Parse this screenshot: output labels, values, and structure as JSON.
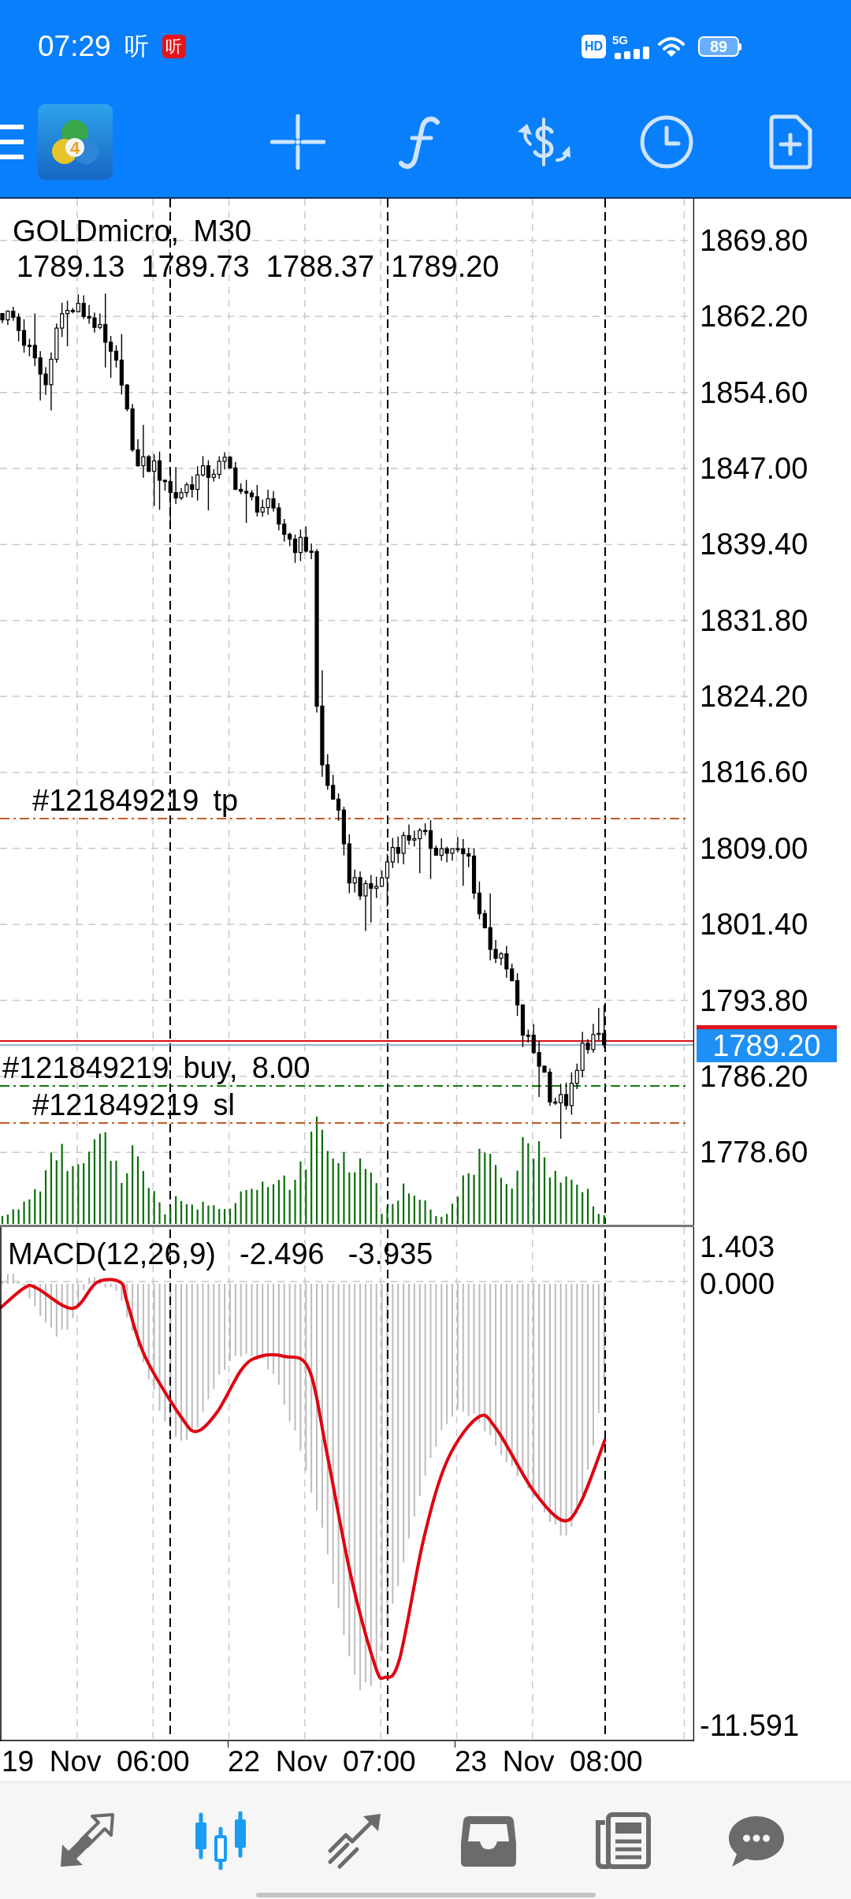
{
  "status_bar": {
    "time": "07:29",
    "notifications": [
      {
        "kind": "glyph",
        "text": "听"
      },
      {
        "kind": "badge",
        "text": "听"
      }
    ],
    "network_badge": "HD",
    "network_type": "5G",
    "battery": "89"
  },
  "toolbar": {
    "logo_mark": "4"
  },
  "chart": {
    "title": "GOLDmicro, M30",
    "ohlc": [
      "1789.13",
      "1789.73",
      "1788.37",
      "1789.20"
    ],
    "orders": [
      {
        "kind": "tp",
        "label": "#121849219 tp"
      },
      {
        "kind": "buy",
        "label": "#121849219 buy, 8.00"
      },
      {
        "kind": "sl",
        "label": "#121849219 sl"
      }
    ],
    "price_axis": [
      "1869.80",
      "1862.20",
      "1854.60",
      "1847.00",
      "1839.40",
      "1831.80",
      "1824.20",
      "1816.60",
      "1809.00",
      "1801.40",
      "1793.80",
      "1786.20",
      "1778.60"
    ],
    "current_price": "1789.20"
  },
  "macd": {
    "label": "MACD(12,26,9)",
    "values": [
      "-2.496",
      "-3.935"
    ],
    "axis": [
      "1.403",
      "0.000",
      "-11.591"
    ]
  },
  "time_axis": [
    "19 Nov 06:00",
    "22 Nov 07:00",
    "23 Nov 08:00"
  ],
  "nav": {
    "items": [
      {
        "selected": false
      },
      {
        "selected": true
      },
      {
        "selected": false
      },
      {
        "selected": false
      },
      {
        "selected": false
      },
      {
        "selected": false
      }
    ]
  }
}
